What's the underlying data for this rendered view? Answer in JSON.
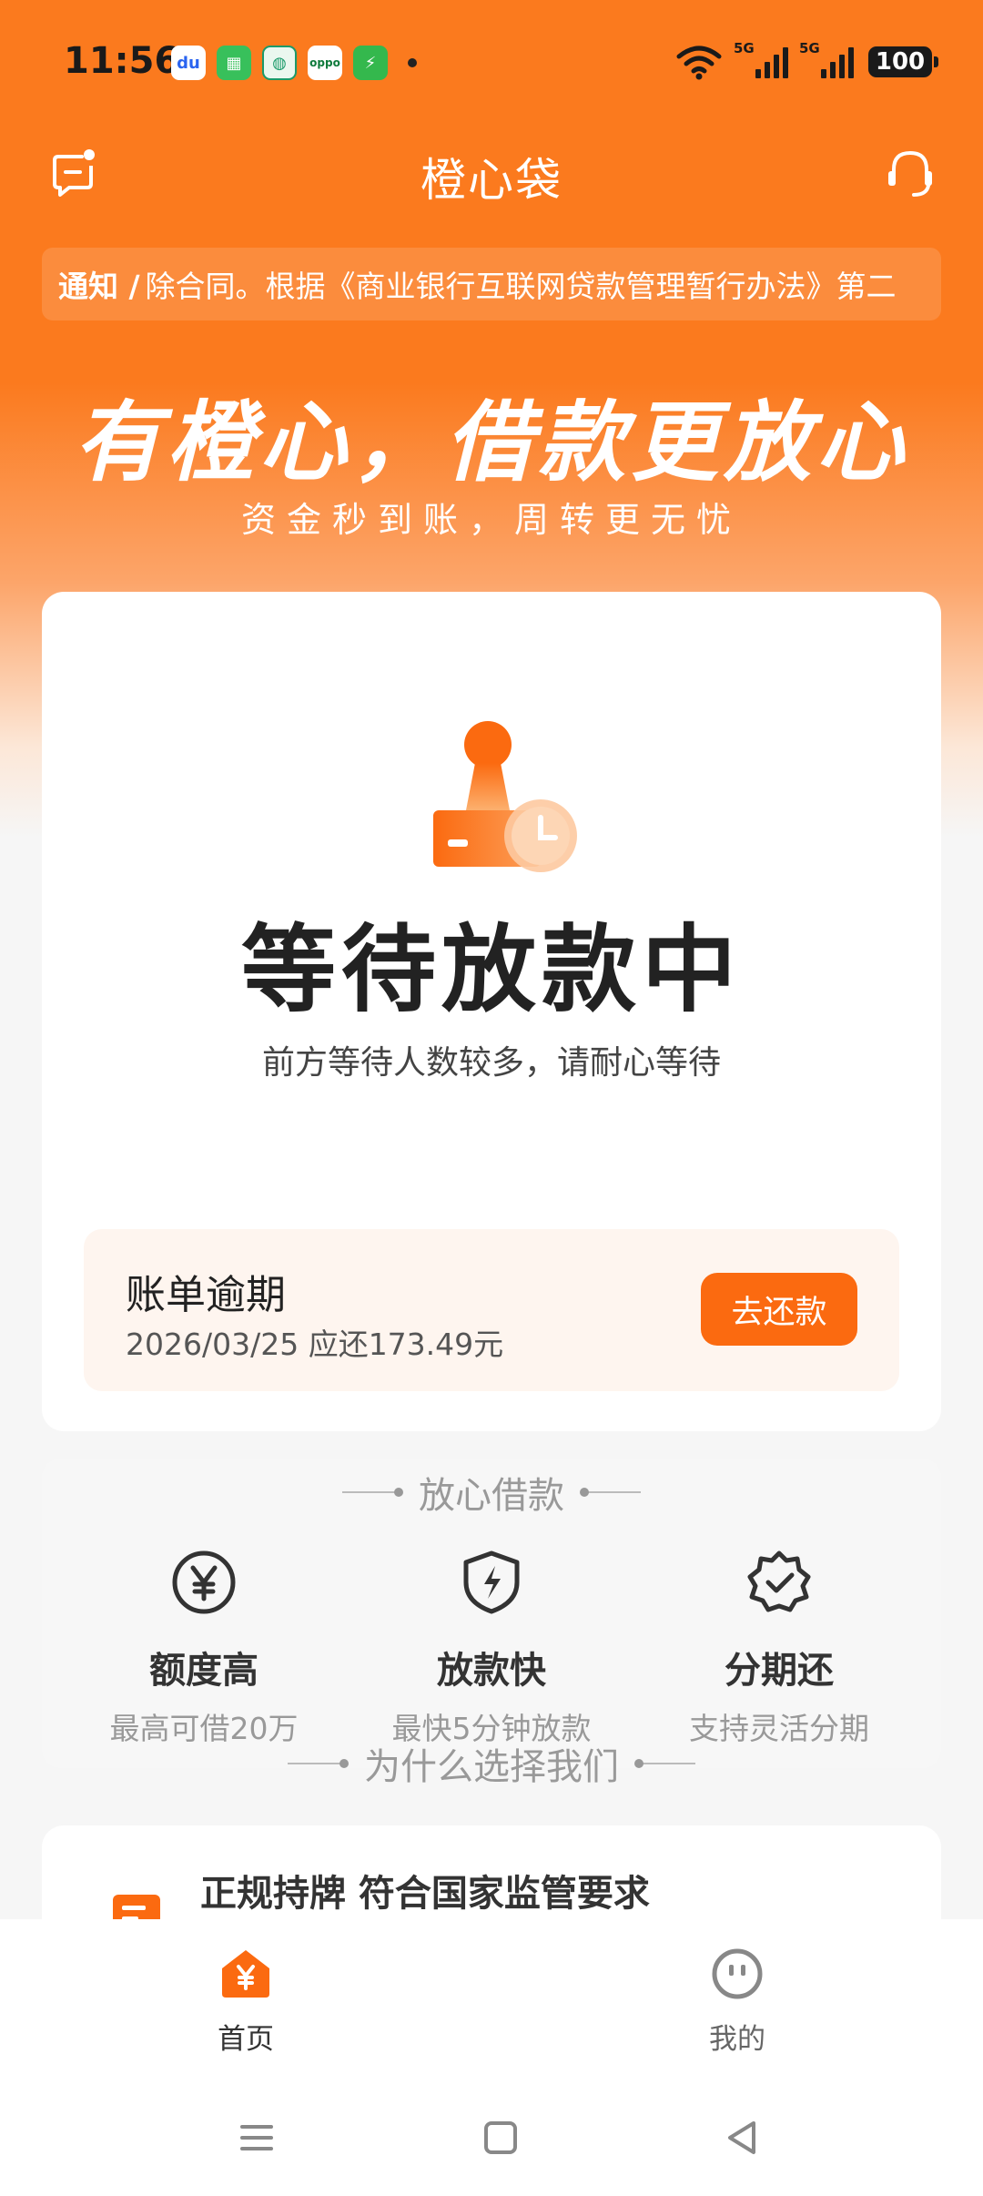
{
  "status_bar": {
    "time": "11:56",
    "notification_icons": [
      "baidu-icon",
      "app-icon",
      "bank-icon",
      "oppo-icon",
      "security-icon"
    ],
    "signal1_label": "5G",
    "signal2_label": "5G",
    "battery": "100"
  },
  "header": {
    "title": "橙心袋"
  },
  "notice": {
    "tag": "通知 /",
    "text": "除合同。根据《商业银行互联网贷款管理暂行办法》第二"
  },
  "hero": {
    "slogan": "有橙心，借款更放心",
    "subslogan": "资金秒到账，周转更无忧"
  },
  "status_card": {
    "title": "等待放款中",
    "subtitle": "前方等待人数较多，请耐心等待",
    "bill": {
      "title": "账单逾期",
      "detail": "2026/03/25 应还173.49元",
      "button": "去还款"
    }
  },
  "features": {
    "heading": "放心借款",
    "items": [
      {
        "icon": "yen-icon",
        "title": "额度高",
        "desc": "最高可借20万"
      },
      {
        "icon": "lightning-shield-icon",
        "title": "放款快",
        "desc": "最快5分钟放款"
      },
      {
        "icon": "check-badge-icon",
        "title": "分期还",
        "desc": "支持灵活分期"
      }
    ],
    "why_heading": "为什么选择我们"
  },
  "license_card": {
    "title": "正规持牌 符合国家监管要求"
  },
  "tabs": [
    {
      "label": "首页",
      "icon": "home-yen-icon",
      "active": true
    },
    {
      "label": "我的",
      "icon": "profile-face-icon",
      "active": false
    }
  ],
  "colors": {
    "brand": "#fb7a1e",
    "button": "#fb6a10"
  }
}
